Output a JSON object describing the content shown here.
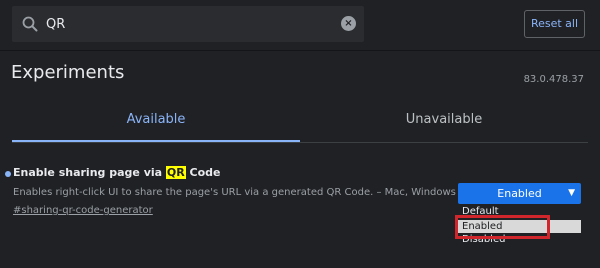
{
  "search": {
    "value": "QR",
    "icon": "search-icon",
    "clear_icon": "close-icon",
    "clear_glyph": "×"
  },
  "header": {
    "reset_label": "Reset all",
    "title": "Experiments",
    "version": "83.0.478.37"
  },
  "tabs": [
    {
      "label": "Available",
      "active": true
    },
    {
      "label": "Unavailable",
      "active": false
    }
  ],
  "experiment": {
    "title_before": "Enable sharing page via ",
    "title_highlight": "QR",
    "title_after": " Code",
    "description": "Enables right-click UI to share the page's URL via a generated QR Code. – Mac, Windows",
    "link": "#sharing-qr-code-generator",
    "selected_value": "Enabled",
    "options": [
      "Default",
      "Enabled",
      "Disabled"
    ]
  },
  "colors": {
    "accent": "#8ab4f8",
    "select_bg": "#1a73e8",
    "highlight": "#ffff00",
    "annotation": "#d1272c"
  }
}
